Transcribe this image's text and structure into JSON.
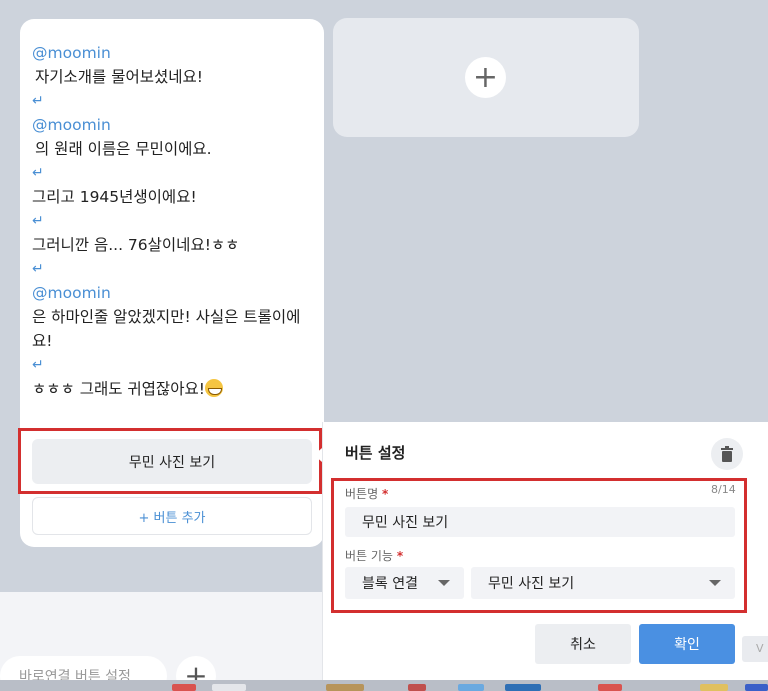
{
  "message": {
    "lines": [
      {
        "type": "mention",
        "text": "@moomin"
      },
      {
        "type": "text",
        "text": " 자기소개를 물어보셨네요!"
      },
      {
        "type": "return",
        "text": "↵"
      },
      {
        "type": "mention",
        "text": "@moomin"
      },
      {
        "type": "text",
        "text": " 의 원래 이름은 무민이에요."
      },
      {
        "type": "return",
        "text": "↵"
      },
      {
        "type": "text",
        "text": "그리고 1945년생이에요!"
      },
      {
        "type": "return",
        "text": "↵"
      },
      {
        "type": "text",
        "text": "그러니깐 음... 76살이네요!ㅎㅎ"
      },
      {
        "type": "return",
        "text": "↵"
      },
      {
        "type": "mention",
        "text": "@moomin"
      },
      {
        "type": "text",
        "text": "은 하마인줄 알았겠지만! 사실은 트롤이에"
      },
      {
        "type": "text",
        "text": "요!"
      },
      {
        "type": "return",
        "text": "↵"
      },
      {
        "type": "text",
        "text": "ㅎㅎㅎ 그래도 귀엽잖아요!"
      }
    ],
    "emoji": "grinning-face-icon",
    "quick_button": "무민 사진 보기",
    "add_button": "+ 버튼 추가"
  },
  "empty_card": {
    "add_icon": "plus-icon"
  },
  "settings": {
    "title": "버튼 설정",
    "name_label": "버튼명",
    "required_mark": "*",
    "counter": "8/14",
    "name_value": "무민 사진 보기",
    "function_label": "버튼 기능",
    "function_type": "블록 연결",
    "function_target": "무민 사진 보기",
    "cancel": "취소",
    "confirm": "확인",
    "ghost": "V"
  },
  "bottom": {
    "quick_reply": "바로연결 버튼 설정"
  },
  "colors": {
    "accent": "#4a90e2",
    "highlight": "#d32f2f",
    "mention": "#4a8fd4"
  }
}
